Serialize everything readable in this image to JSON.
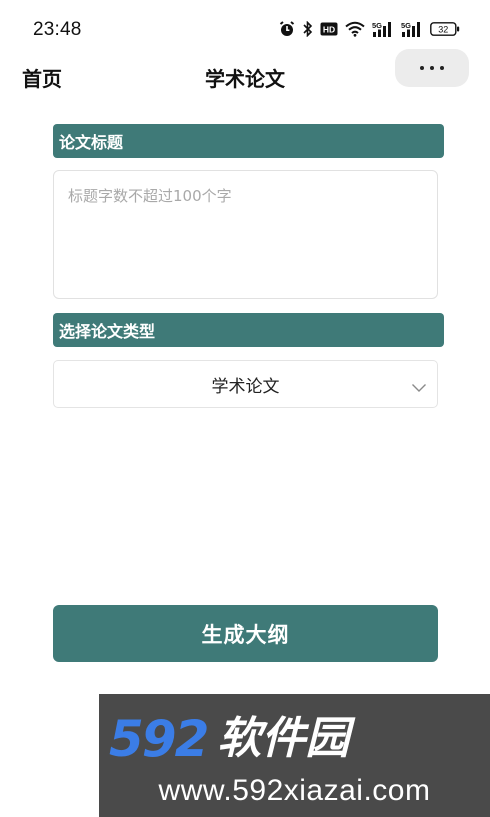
{
  "status_bar": {
    "time": "23:48",
    "icons": [
      "alarm-icon",
      "bluetooth-icon",
      "hd-icon",
      "wifi-icon",
      "signal-5g-icon",
      "signal-5g-icon",
      "battery-icon"
    ],
    "net_label_1": "5G",
    "net_label_2": "5G",
    "hd_label": "HD",
    "battery_level": "32"
  },
  "nav": {
    "home_label": "首页",
    "title": "学术论文",
    "more_icon": "more-dots-icon"
  },
  "form": {
    "title_section_label": "论文标题",
    "title_placeholder": "标题字数不超过100个字",
    "title_value": "",
    "type_section_label": "选择论文类型",
    "type_selected": "学术论文",
    "select_icon": "chevron-down-icon"
  },
  "actions": {
    "generate_label": "生成大纲"
  },
  "watermark": {
    "logo_number": "592",
    "logo_text": "软件园",
    "url": "www.592xiazai.com"
  },
  "colors": {
    "accent": "#3f7a78",
    "watermark_bg": "#4a4a4a",
    "watermark_blue": "#3b7de6"
  }
}
